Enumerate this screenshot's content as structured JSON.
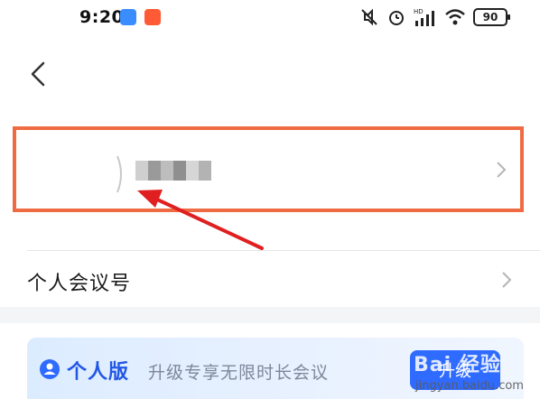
{
  "status_bar": {
    "time": "9:20",
    "battery": "90",
    "network_label": "HD"
  },
  "profile": {
    "name_placeholder": ""
  },
  "meeting": {
    "label": "个人会议号"
  },
  "banner": {
    "title": "个人版",
    "description": "升级专享无限时长会议",
    "button_label": "升级"
  },
  "watermark": {
    "brand": "Bai 经验",
    "url": "jingyan.baidu.com"
  },
  "colors": {
    "highlight_border": "#ef6b43",
    "arrow": "#e02020",
    "accent": "#2f6bff"
  }
}
